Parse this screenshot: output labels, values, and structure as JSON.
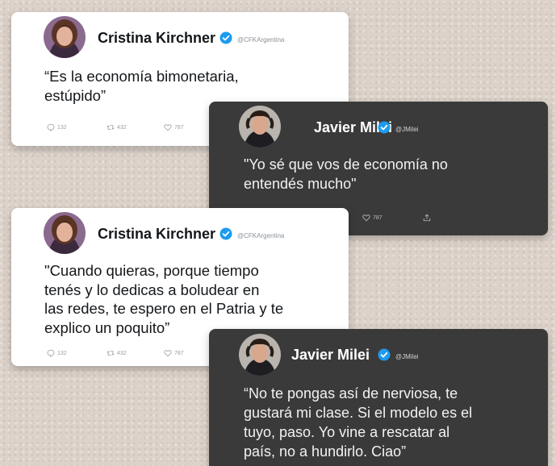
{
  "tweets": [
    {
      "theme": "light",
      "author": "Cristina Kirchner",
      "handle": "@CFKArgentina",
      "lines": [
        "“Es la economía bimonetaria,",
        "estúpido”"
      ],
      "replies": "132",
      "retweets": "432",
      "likes": "787"
    },
    {
      "theme": "dark",
      "author": "Javier Milei",
      "handle": "@JMilei",
      "lines": [
        "\"Yo sé que vos de economía no",
        "entendés mucho\""
      ],
      "likes": "787"
    },
    {
      "theme": "light",
      "author": "Cristina Kirchner",
      "handle": "@CFKArgentina",
      "lines": [
        "\"Cuando quieras, porque tiempo",
        "tenés y lo dedicas a boludear en",
        "las redes, te espero en el Patria y te",
        "explico un poquito”"
      ],
      "replies": "132",
      "retweets": "432",
      "likes": "787"
    },
    {
      "theme": "dark",
      "author": "Javier Milei",
      "handle": "@JMilei",
      "lines": [
        "“No te pongas así de nerviosa, te",
        "gustará mi clase. Si el modelo es el",
        "tuyo, paso. Yo vine a rescatar al",
        "país, no a hundirlo. Ciao”"
      ]
    }
  ],
  "colors": {
    "verified": "#1d9bf0",
    "background": "#dcd2ca",
    "dark_card": "#3a3a3a"
  },
  "icons": [
    "reply-icon",
    "retweet-icon",
    "like-icon",
    "share-icon",
    "verified-badge-icon"
  ]
}
